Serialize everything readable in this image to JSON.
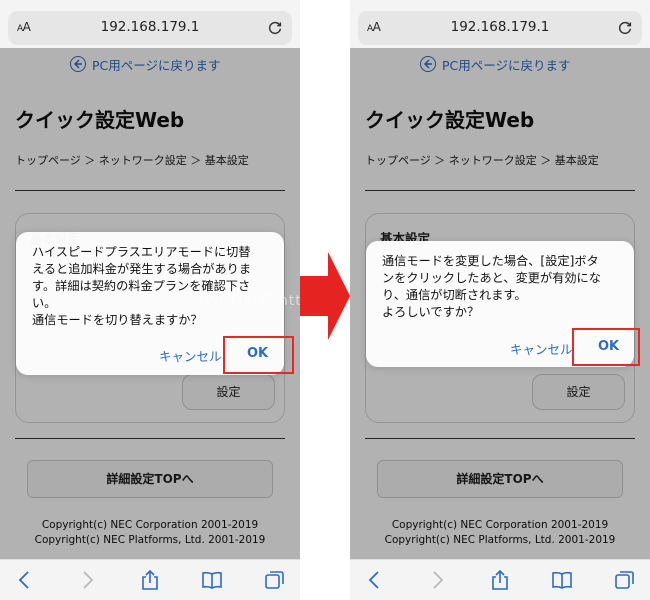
{
  "browser": {
    "aa_label": "AA",
    "url": "192.168.179.1"
  },
  "page": {
    "back_link": "PC用ページに戻ります",
    "title": "クイック設定Web",
    "breadcrumb": "トップページ ＞ ネットワーク設定 ＞ 基本設定",
    "card_title": "基本設定",
    "set_button": "設定",
    "detail_button": "詳細設定TOPへ",
    "copyright_lines": [
      "Copyright(c) NEC Corporation 2001-2019",
      "Copyright(c) NEC Platforms, Ltd. 2001-2019"
    ]
  },
  "dialog_left": {
    "lines": [
      "ハイスピードプラスエリアモードに切替",
      "えると追加料金が発生する場合がありま",
      "す。詳細は契約の料金プランを確認下さ",
      "い。",
      "通信モードを切り替えますか？"
    ],
    "cancel": "キャンセル",
    "ok": "OK"
  },
  "dialog_right": {
    "lines": [
      "通信モードを変更した場合、[設定]ボタ",
      "ンをクリックしたあと、変更が有効にな",
      "り、通信が切断されます。",
      "よろしいですか？"
    ],
    "cancel": "キャンセル",
    "ok": "OK"
  },
  "watermark": "©Wi-Fiの森 https://wifinomori",
  "colors": {
    "link_blue": "#2d6bc4",
    "highlight_red": "#e22a2a",
    "arrow_red": "#e52421"
  },
  "icons": {
    "toolbar": [
      "back-icon",
      "forward-icon",
      "share-icon",
      "bookmarks-icon",
      "tabs-icon"
    ],
    "url_bar": [
      "reload-icon"
    ],
    "back_link": "back-arrow-circle-icon"
  }
}
